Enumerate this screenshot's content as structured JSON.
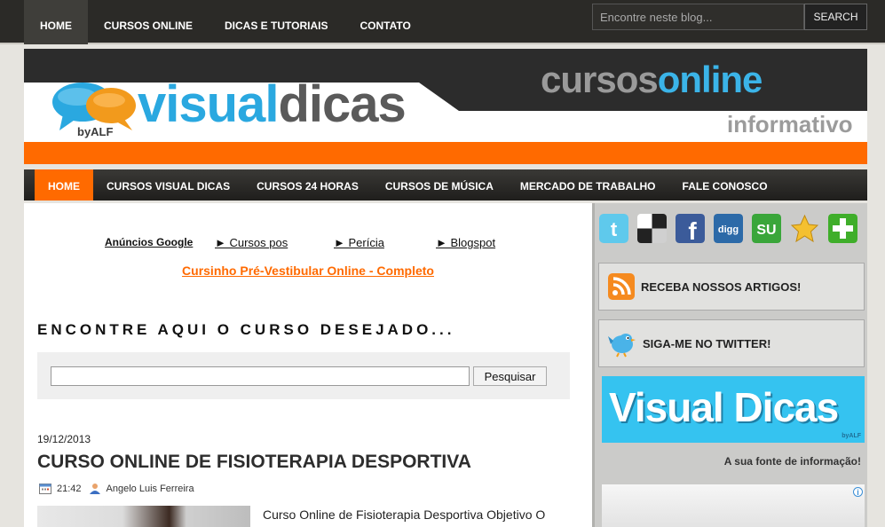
{
  "topnav": {
    "items": [
      {
        "label": "HOME",
        "active": true
      },
      {
        "label": "CURSOS ONLINE",
        "active": false
      },
      {
        "label": "DICAS E TUTORIAIS",
        "active": false
      },
      {
        "label": "CONTATO",
        "active": false
      }
    ],
    "search_placeholder": "Encontre neste blog...",
    "search_button": "SEARCH"
  },
  "banner": {
    "logo_visual": "visual",
    "logo_dicas": "dicas",
    "logo_by": "byALF",
    "cursos": "cursos",
    "online": "online",
    "informativo": "informativo",
    "colors": {
      "orange": "#ff6a00",
      "blue": "#2aa8e0",
      "dark": "#2c2c2c"
    }
  },
  "mainnav": {
    "items": [
      {
        "label": "HOME",
        "active": true
      },
      {
        "label": "CURSOS VISUAL DICAS",
        "active": false
      },
      {
        "label": "CURSOS 24 HORAS",
        "active": false
      },
      {
        "label": "CURSOS DE MÚSICA",
        "active": false
      },
      {
        "label": "MERCADO DE TRABALHO",
        "active": false
      },
      {
        "label": "FALE CONOSCO",
        "active": false
      }
    ]
  },
  "ads": {
    "title": "Anúncios Google",
    "links": [
      "► Cursos pos",
      "► Perícia",
      "► Blogspot"
    ],
    "promo": "Cursinho Pré-Vestibular Online - Completo"
  },
  "course_search": {
    "title": "ENCONTRE AQUI O CURSO DESEJADO...",
    "input_value": "",
    "button": "Pesquisar"
  },
  "post": {
    "date": "19/12/2013",
    "title": "CURSO ONLINE DE FISIOTERAPIA DESPORTIVA",
    "time": "21:42",
    "author": "Angelo Luis Ferreira",
    "excerpt": "Curso Online de Fisioterapia Desportiva Objetivo O"
  },
  "sidebar": {
    "social_icons": [
      "twitter-icon",
      "delicious-icon",
      "facebook-icon",
      "digg-icon",
      "stumbleupon-icon",
      "favorite-star-icon",
      "add-plus-icon"
    ],
    "rss_label": "RECEBA NOSSOS ARTIGOS!",
    "twitter_label": "SIGA-ME NO TWITTER!",
    "logo_text": "Visual Dicas",
    "logo_small": "byALF",
    "tagline": "A sua fonte de informação!"
  }
}
